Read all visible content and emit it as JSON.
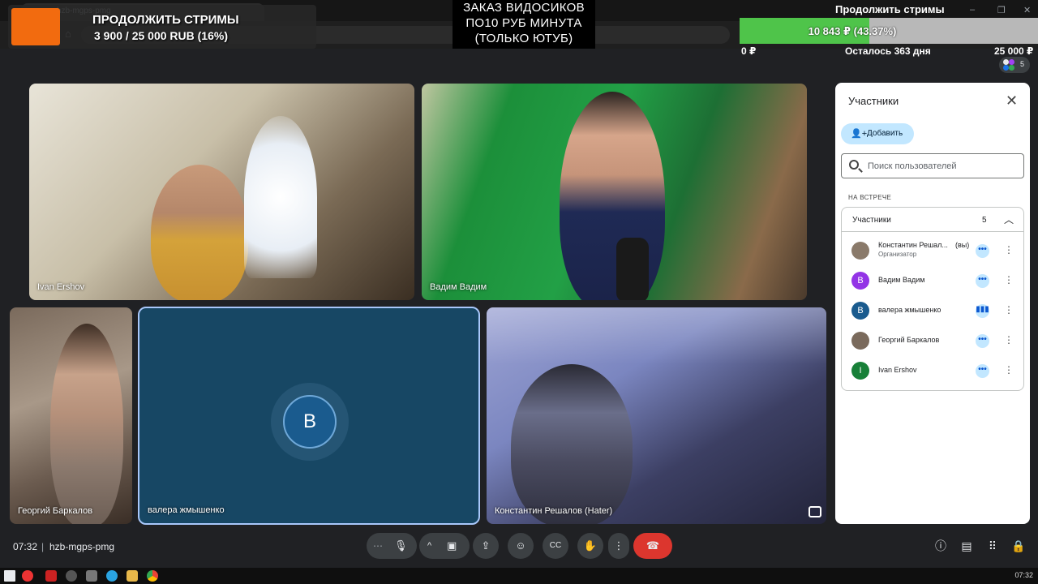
{
  "browser": {
    "tab_title": "hzb-mgps-pmg",
    "window_controls": [
      "–",
      "❐",
      "✕"
    ]
  },
  "overlay": {
    "donate_title": "ПРОДОЛЖИТЬ СТРИМЫ",
    "donate_amount": "3 900 / 25 000 RUB (16%)",
    "order_lines": [
      "ЗАКАЗ ВИДОСИКОВ",
      "ПО10 РУБ МИНУТА",
      "(ТОЛЬКО ЮТУБ)"
    ],
    "goal_title": "Продолжить стримы",
    "goal_progress_text": "10 843 ₽ (43.37%)",
    "goal_progress": 0.4337,
    "goal_min": "0 ₽",
    "goal_remaining": "Осталось 363 дня",
    "goal_max": "25 000 ₽",
    "mini_participant_count": "5",
    "colors": {
      "donate_logo": "#f26b0f",
      "goal_fill": "#4fc44a",
      "goal_track": "#b8b8b8"
    }
  },
  "tiles": {
    "ivan": "Ivan Ershov",
    "vadim": "Вадим Вадим",
    "georgiy": "Георгий Баркалов",
    "valera": "валера жмышенко",
    "valera_avatar": "В",
    "konstantin": "Константин Решалов (Hater)"
  },
  "panel": {
    "title": "Участники",
    "add_label": "Добавить",
    "search_placeholder": "Поиск пользователей",
    "section_label": "НА ВСТРЕЧЕ",
    "list_header": "Участники",
    "list_count": "5",
    "participants": [
      {
        "name": "Константин Решал...",
        "you": "(вы)",
        "role": "Организатор",
        "avatar": "",
        "avatar_color": "#8a7a6a"
      },
      {
        "name": "Вадим Вадим",
        "avatar": "В",
        "avatar_color": "#9334e6"
      },
      {
        "name": "валера жмышенко",
        "avatar": "В",
        "avatar_color": "#1a5b8e"
      },
      {
        "name": "Георгий Баркалов",
        "avatar": "",
        "avatar_color": "#7a6a5c"
      },
      {
        "name": "Ivan Ershov",
        "avatar": "I",
        "avatar_color": "#188038"
      }
    ]
  },
  "bottom": {
    "time": "07:32",
    "separator": "|",
    "meeting_code": "hzb-mgps-pmg",
    "controls": {
      "more_options": "⋯",
      "mic": "🎙",
      "camera_options": "^",
      "camera": "▣",
      "present": "⇪",
      "emoji": "☺",
      "captions": "CC",
      "raise_hand": "✋",
      "more": "⋮",
      "end_call": "☎"
    },
    "right_icons": {
      "info": "ⓘ",
      "chat": "▤",
      "activities": "⠿",
      "host_controls": "🔒"
    }
  },
  "taskbar": {
    "clock": "07:32"
  }
}
